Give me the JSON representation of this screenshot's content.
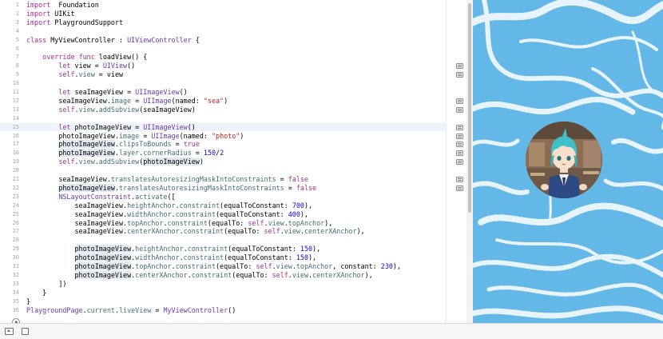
{
  "editor": {
    "current_line": 15,
    "lines": [
      {
        "n": "1",
        "tokens": [
          [
            "kw",
            "import"
          ],
          [
            "",
            "  Foundation"
          ]
        ]
      },
      {
        "n": "2",
        "tokens": [
          [
            "kw",
            "import"
          ],
          [
            "",
            " UIKit"
          ]
        ]
      },
      {
        "n": "3",
        "tokens": [
          [
            "kw",
            "import"
          ],
          [
            "",
            " PlaygroundSupport"
          ]
        ]
      },
      {
        "n": "4",
        "tokens": []
      },
      {
        "n": "5",
        "tokens": [
          [
            "kw",
            "class"
          ],
          [
            "",
            " MyViewController : "
          ],
          [
            "ty",
            "UIViewController"
          ],
          [
            "",
            " {"
          ]
        ]
      },
      {
        "n": "6",
        "tokens": []
      },
      {
        "n": "7",
        "tokens": [
          [
            "",
            "    "
          ],
          [
            "kw",
            "override"
          ],
          [
            "",
            " "
          ],
          [
            "kw",
            "func"
          ],
          [
            "",
            " loadView() {"
          ]
        ]
      },
      {
        "n": "8",
        "tokens": [
          [
            "",
            "        "
          ],
          [
            "kw",
            "let"
          ],
          [
            "",
            " view = "
          ],
          [
            "ty",
            "UIView"
          ],
          [
            "",
            "()"
          ]
        ]
      },
      {
        "n": "9",
        "tokens": [
          [
            "",
            "        "
          ],
          [
            "kw",
            "self"
          ],
          [
            "",
            "."
          ],
          [
            "ac",
            "view"
          ],
          [
            "",
            " = view"
          ]
        ]
      },
      {
        "n": "10",
        "tokens": []
      },
      {
        "n": "11",
        "tokens": [
          [
            "",
            "        "
          ],
          [
            "kw",
            "let"
          ],
          [
            "",
            " seaImageView = "
          ],
          [
            "ty",
            "UIImageView"
          ],
          [
            "",
            "()"
          ]
        ]
      },
      {
        "n": "12",
        "tokens": [
          [
            "",
            "        seaImageView."
          ],
          [
            "ac",
            "image"
          ],
          [
            "",
            " = "
          ],
          [
            "ty",
            "UIImage"
          ],
          [
            "",
            "(named: "
          ],
          [
            "st",
            "\"sea\""
          ],
          [
            "",
            ")"
          ]
        ]
      },
      {
        "n": "13",
        "tokens": [
          [
            "",
            "        "
          ],
          [
            "kw",
            "self"
          ],
          [
            "",
            "."
          ],
          [
            "ac",
            "view"
          ],
          [
            "",
            "."
          ],
          [
            "ac",
            "addSubview"
          ],
          [
            "",
            "(seaImageView)"
          ]
        ]
      },
      {
        "n": "14",
        "tokens": []
      },
      {
        "n": "15",
        "tokens": [
          [
            "",
            "        "
          ],
          [
            "kw",
            "let"
          ],
          [
            "",
            " photoImageView = "
          ],
          [
            "ty",
            "UIImageView"
          ],
          [
            "",
            "()"
          ]
        ]
      },
      {
        "n": "16",
        "tokens": [
          [
            "",
            "        photoImageView."
          ],
          [
            "ac",
            "image"
          ],
          [
            "",
            " = "
          ],
          [
            "ty",
            "UIImage"
          ],
          [
            "",
            "(named: "
          ],
          [
            "st",
            "\"photo\""
          ],
          [
            "",
            ")"
          ]
        ]
      },
      {
        "n": "17",
        "tokens": [
          [
            "",
            "        "
          ],
          [
            "hl",
            "photoImageView"
          ],
          [
            "",
            "."
          ],
          [
            "ac",
            "clipsToBounds"
          ],
          [
            "",
            " = "
          ],
          [
            "kw",
            "true"
          ]
        ]
      },
      {
        "n": "18",
        "tokens": [
          [
            "",
            "        "
          ],
          [
            "hl",
            "photoImageView"
          ],
          [
            "",
            "."
          ],
          [
            "ac",
            "layer"
          ],
          [
            "",
            "."
          ],
          [
            "ac",
            "cornerRadius"
          ],
          [
            "",
            " = "
          ],
          [
            "nu",
            "150"
          ],
          [
            "",
            "/"
          ],
          [
            "nu",
            "2"
          ]
        ]
      },
      {
        "n": "19",
        "tokens": [
          [
            "",
            "        "
          ],
          [
            "kw",
            "self"
          ],
          [
            "",
            "."
          ],
          [
            "ac",
            "view"
          ],
          [
            "",
            "."
          ],
          [
            "ac",
            "addSubview"
          ],
          [
            "",
            "("
          ],
          [
            "hl",
            "photoImageView"
          ],
          [
            "",
            ")"
          ]
        ]
      },
      {
        "n": "20",
        "tokens": []
      },
      {
        "n": "21",
        "tokens": [
          [
            "",
            "        seaImageView."
          ],
          [
            "ac",
            "translatesAutoresizingMaskIntoConstraints"
          ],
          [
            "",
            " = "
          ],
          [
            "kw",
            "false"
          ]
        ]
      },
      {
        "n": "22",
        "tokens": [
          [
            "",
            "        "
          ],
          [
            "hl",
            "photoImageView"
          ],
          [
            "",
            "."
          ],
          [
            "ac",
            "translatesAutoresizingMaskIntoConstraints"
          ],
          [
            "",
            " = "
          ],
          [
            "kw",
            "false"
          ]
        ]
      },
      {
        "n": "23",
        "tokens": [
          [
            "",
            "        "
          ],
          [
            "ty",
            "NSLayoutConstraint"
          ],
          [
            "",
            "."
          ],
          [
            "ac",
            "activate"
          ],
          [
            "",
            "(["
          ]
        ]
      },
      {
        "n": "24",
        "tokens": [
          [
            "",
            "            seaImageView."
          ],
          [
            "ac",
            "heightAnchor"
          ],
          [
            "",
            "."
          ],
          [
            "ac",
            "constraint"
          ],
          [
            "",
            "(equalToConstant: "
          ],
          [
            "nu",
            "700"
          ],
          [
            "",
            "),"
          ]
        ]
      },
      {
        "n": "25",
        "tokens": [
          [
            "",
            "            seaImageView."
          ],
          [
            "ac",
            "widthAnchor"
          ],
          [
            "",
            "."
          ],
          [
            "ac",
            "constraint"
          ],
          [
            "",
            "(equalToConstant: "
          ],
          [
            "nu",
            "400"
          ],
          [
            "",
            "),"
          ]
        ]
      },
      {
        "n": "26",
        "tokens": [
          [
            "",
            "            seaImageView."
          ],
          [
            "ac",
            "topAnchor"
          ],
          [
            "",
            "."
          ],
          [
            "ac",
            "constraint"
          ],
          [
            "",
            "(equalTo: "
          ],
          [
            "kw",
            "self"
          ],
          [
            "",
            "."
          ],
          [
            "ac",
            "view"
          ],
          [
            "",
            "."
          ],
          [
            "ac",
            "topAnchor"
          ],
          [
            "",
            "),"
          ]
        ]
      },
      {
        "n": "27",
        "tokens": [
          [
            "",
            "            seaImageView."
          ],
          [
            "ac",
            "centerXAnchor"
          ],
          [
            "",
            "."
          ],
          [
            "ac",
            "constraint"
          ],
          [
            "",
            "(equalTo: "
          ],
          [
            "kw",
            "self"
          ],
          [
            "",
            "."
          ],
          [
            "ac",
            "view"
          ],
          [
            "",
            "."
          ],
          [
            "ac",
            "centerXAnchor"
          ],
          [
            "",
            "),"
          ]
        ]
      },
      {
        "n": "28",
        "tokens": []
      },
      {
        "n": "29",
        "tokens": [
          [
            "",
            "            "
          ],
          [
            "hl",
            "photoImageView"
          ],
          [
            "",
            "."
          ],
          [
            "ac",
            "heightAnchor"
          ],
          [
            "",
            "."
          ],
          [
            "ac",
            "constraint"
          ],
          [
            "",
            "(equalToConstant: "
          ],
          [
            "nu",
            "150"
          ],
          [
            "",
            "),"
          ]
        ]
      },
      {
        "n": "30",
        "tokens": [
          [
            "",
            "            "
          ],
          [
            "hl",
            "photoImageView"
          ],
          [
            "",
            "."
          ],
          [
            "ac",
            "widthAnchor"
          ],
          [
            "",
            "."
          ],
          [
            "ac",
            "constraint"
          ],
          [
            "",
            "(equalToConstant: "
          ],
          [
            "nu",
            "150"
          ],
          [
            "",
            "),"
          ]
        ]
      },
      {
        "n": "31",
        "tokens": [
          [
            "",
            "            "
          ],
          [
            "hl",
            "photoImageView"
          ],
          [
            "",
            "."
          ],
          [
            "ac",
            "topAnchor"
          ],
          [
            "",
            "."
          ],
          [
            "ac",
            "constraint"
          ],
          [
            "",
            "(equalTo: "
          ],
          [
            "kw",
            "self"
          ],
          [
            "",
            "."
          ],
          [
            "ac",
            "view"
          ],
          [
            "",
            "."
          ],
          [
            "ac",
            "topAnchor"
          ],
          [
            "",
            ", constant: "
          ],
          [
            "nu",
            "230"
          ],
          [
            "",
            "),"
          ]
        ]
      },
      {
        "n": "32",
        "tokens": [
          [
            "",
            "            "
          ],
          [
            "hl",
            "photoImageView"
          ],
          [
            "",
            "."
          ],
          [
            "ac",
            "centerXAnchor"
          ],
          [
            "",
            "."
          ],
          [
            "ac",
            "constraint"
          ],
          [
            "",
            "(equalTo: "
          ],
          [
            "kw",
            "self"
          ],
          [
            "",
            "."
          ],
          [
            "ac",
            "view"
          ],
          [
            "",
            "."
          ],
          [
            "ac",
            "centerXAnchor"
          ],
          [
            "",
            "),"
          ]
        ]
      },
      {
        "n": "33",
        "tokens": [
          [
            "",
            "        ])"
          ]
        ]
      },
      {
        "n": "34",
        "tokens": [
          [
            "",
            "    }"
          ]
        ]
      },
      {
        "n": "35",
        "tokens": [
          [
            "",
            "}"
          ]
        ]
      },
      {
        "n": "36",
        "tokens": [
          [
            "ty",
            "PlaygroundPage"
          ],
          [
            "",
            "."
          ],
          [
            "ac",
            "current"
          ],
          [
            "",
            "."
          ],
          [
            "ac",
            "liveView"
          ],
          [
            "",
            " = "
          ],
          [
            "ty",
            "MyViewController"
          ],
          [
            "",
            "()"
          ]
        ]
      }
    ]
  },
  "gutter": {
    "result_lines": [
      8,
      9,
      12,
      13,
      15,
      16,
      17,
      18,
      19,
      21,
      22
    ]
  },
  "live_view": {
    "sea_image": "sea",
    "photo_image": "photo"
  },
  "icons": {
    "run": "play-circle-icon",
    "debug_area": "debug-area-toggle-icon",
    "console": "console-toggle-icon",
    "result": "quick-look-result-icon"
  },
  "colors": {
    "keyword": "#a42e93",
    "type": "#6c36a9",
    "property": "#3e6d74",
    "string": "#c41a16",
    "number": "#1c00cf",
    "sea": "#64b8e8"
  }
}
